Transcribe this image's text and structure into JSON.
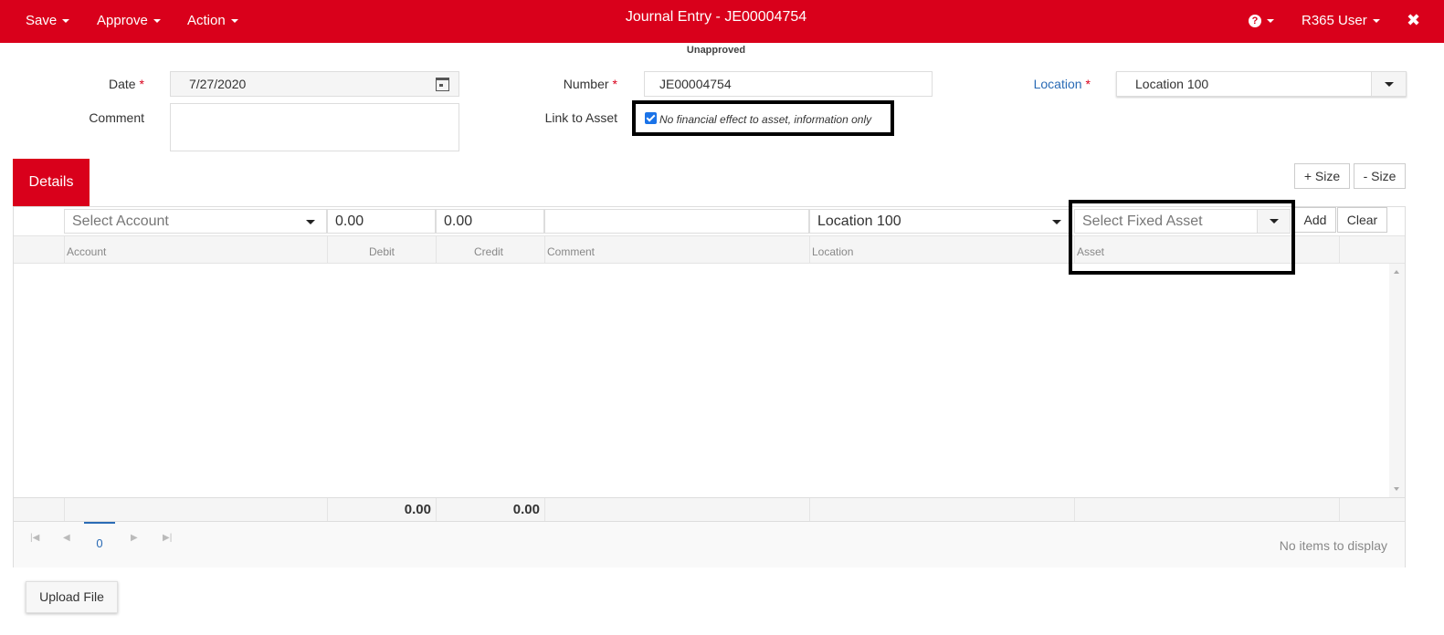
{
  "topbar": {
    "menus": {
      "save": "Save",
      "approve": "Approve",
      "action": "Action"
    },
    "title": "Journal Entry - JE00004754",
    "user": "R365 User",
    "help_icon": "question-circle-icon",
    "close_icon": "close-icon",
    "background_color": "#d9001b"
  },
  "status": "Unapproved",
  "form": {
    "date_label": "Date",
    "date_value": "7/27/2020",
    "comment_label": "Comment",
    "comment_value": "",
    "number_label": "Number",
    "number_value": "JE00004754",
    "link_to_asset_label": "Link to Asset",
    "link_to_asset_checkbox_text": "No financial effect to asset, information only",
    "link_to_asset_checked": true,
    "location_label": "Location",
    "location_value": "Location 100",
    "required_marker": "*"
  },
  "details": {
    "tab_label": "Details",
    "size_plus": "+ Size",
    "size_minus": "- Size",
    "input_row": {
      "account_placeholder": "Select Account",
      "debit": "0.00",
      "credit": "0.00",
      "comment": "",
      "location": "Location 100",
      "asset_placeholder": "Select Fixed Asset",
      "add_label": "Add",
      "clear_label": "Clear"
    },
    "columns": [
      "Account",
      "Debit",
      "Credit",
      "Comment",
      "Location",
      "Asset"
    ],
    "totals": {
      "debit": "0.00",
      "credit": "0.00"
    },
    "pager": {
      "page": "0",
      "no_items": "No items to display"
    }
  },
  "upload_label": "Upload File"
}
